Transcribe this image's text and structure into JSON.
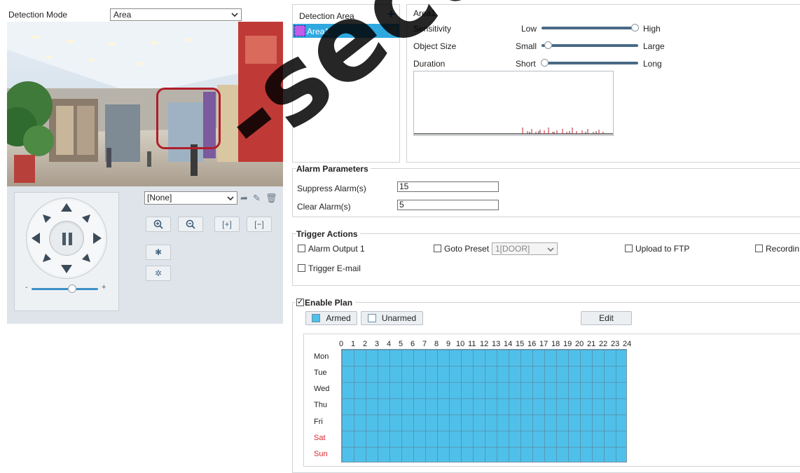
{
  "detection_mode": {
    "label": "Detection Mode",
    "value": "Area"
  },
  "ptz": {
    "preset_value": "[None]"
  },
  "detection_area": {
    "header": "Detection Area",
    "items": [
      {
        "label": "Area1",
        "color": "#c35be8"
      }
    ]
  },
  "area_params": {
    "title": "Area1",
    "sensitivity": {
      "label": "Sensitivity",
      "low": "Low",
      "high": "High",
      "value": 1.0
    },
    "object_size": {
      "label": "Object Size",
      "low": "Small",
      "high": "Large",
      "value": 0.0
    },
    "duration": {
      "label": "Duration",
      "low": "Short",
      "high": "Long",
      "value": 0.0
    }
  },
  "alarm_parameters": {
    "title": "Alarm Parameters",
    "suppress": {
      "label": "Suppress Alarm(s)",
      "value": "15"
    },
    "clear": {
      "label": "Clear Alarm(s)",
      "value": "5"
    }
  },
  "trigger_actions": {
    "title": "Trigger Actions",
    "alarm_output": "Alarm Output 1",
    "goto_preset": "Goto Preset",
    "preset_value": "1[DOOR]",
    "upload_ftp": "Upload to FTP",
    "recording": "Recordin",
    "trigger_email": "Trigger E-mail"
  },
  "plan": {
    "enable_label": "Enable Plan",
    "enabled": true,
    "armed_label": "Armed",
    "unarmed_label": "Unarmed",
    "edit_label": "Edit",
    "hours": [
      "0",
      "1",
      "2",
      "3",
      "4",
      "5",
      "6",
      "7",
      "8",
      "9",
      "10",
      "11",
      "12",
      "13",
      "14",
      "15",
      "16",
      "17",
      "18",
      "19",
      "20",
      "21",
      "22",
      "23",
      "24"
    ],
    "days": [
      "Mon",
      "Tue",
      "Wed",
      "Thu",
      "Fri",
      "Sat",
      "Sun"
    ],
    "weekend_color": "#d9272e",
    "armed_color": "#4fc0ea"
  },
  "watermark": {
    "text": "-security.co"
  }
}
